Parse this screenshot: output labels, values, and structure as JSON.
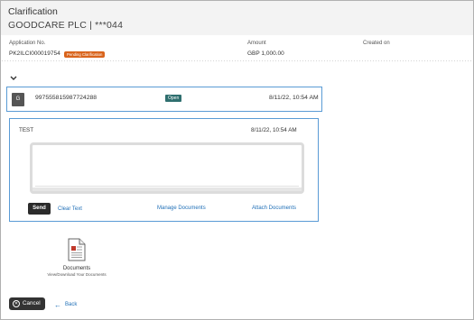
{
  "header": {
    "title": "Clarification",
    "subtitle": "GOODCARE PLC | ***044"
  },
  "info": {
    "application_label": "Application No.",
    "application_value": "PK2ILCI000019754",
    "status_badge": "Pending Clarification",
    "amount_label": "Amount",
    "amount_value": "GBP 1,000.00",
    "created_label": "Created on",
    "created_value": ""
  },
  "message": {
    "avatar_letter": "G",
    "id": "997555815987724288",
    "status": "Open",
    "date": "8/11/22, 10:54 AM"
  },
  "compose": {
    "title": "TEST",
    "date": "8/11/22, 10:54 AM",
    "editor_value": "",
    "send_label": "Send",
    "clear_label": "Clear Text",
    "manage_label": "Manage Documents",
    "attach_label": "Attach Documents"
  },
  "documents": {
    "title": "Documents",
    "subtitle": "View/Download Your Documents",
    "icon": "document-icon"
  },
  "footer": {
    "cancel_label": "Cancel",
    "back_label": "Back"
  },
  "colors": {
    "accent": "#5a9bd5",
    "link": "#1f6fb7",
    "pending": "#d9641c",
    "open": "#2f6f6f",
    "dark_button": "#2b2b2b"
  }
}
